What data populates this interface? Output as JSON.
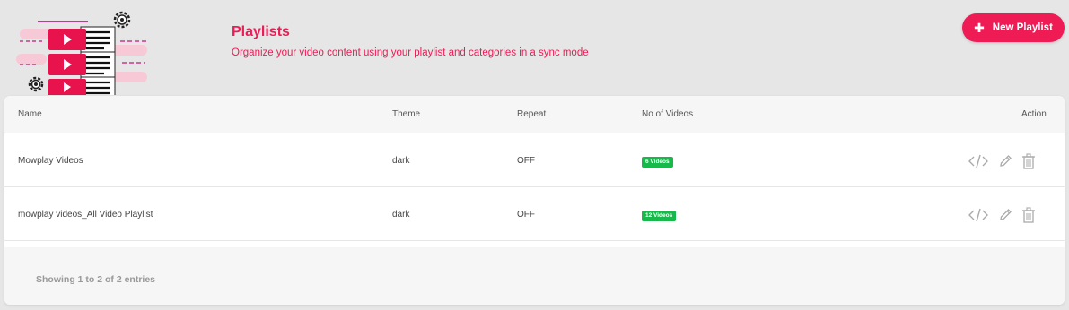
{
  "header": {
    "title": "Playlists",
    "subtitle": "Organize your video content using your playlist and categories in a sync mode",
    "new_button_label": "New Playlist",
    "brand_color": "#ee1b55"
  },
  "table": {
    "columns": {
      "name": "Name",
      "theme": "Theme",
      "repeat": "Repeat",
      "videos": "No of Videos",
      "action": "Action"
    },
    "rows": [
      {
        "name": "Mowplay Videos",
        "theme": "dark",
        "repeat": "OFF",
        "videos": "6 Videos"
      },
      {
        "name": "mowplay videos_All Video Playlist",
        "theme": "dark",
        "repeat": "OFF",
        "videos": "12 Videos"
      }
    ],
    "row_actions": [
      "code-icon",
      "pencil-icon",
      "trash-icon"
    ],
    "badge_color": "#18b94b"
  },
  "footer": {
    "entries_text": "Showing 1 to 2 of 2 entries"
  }
}
